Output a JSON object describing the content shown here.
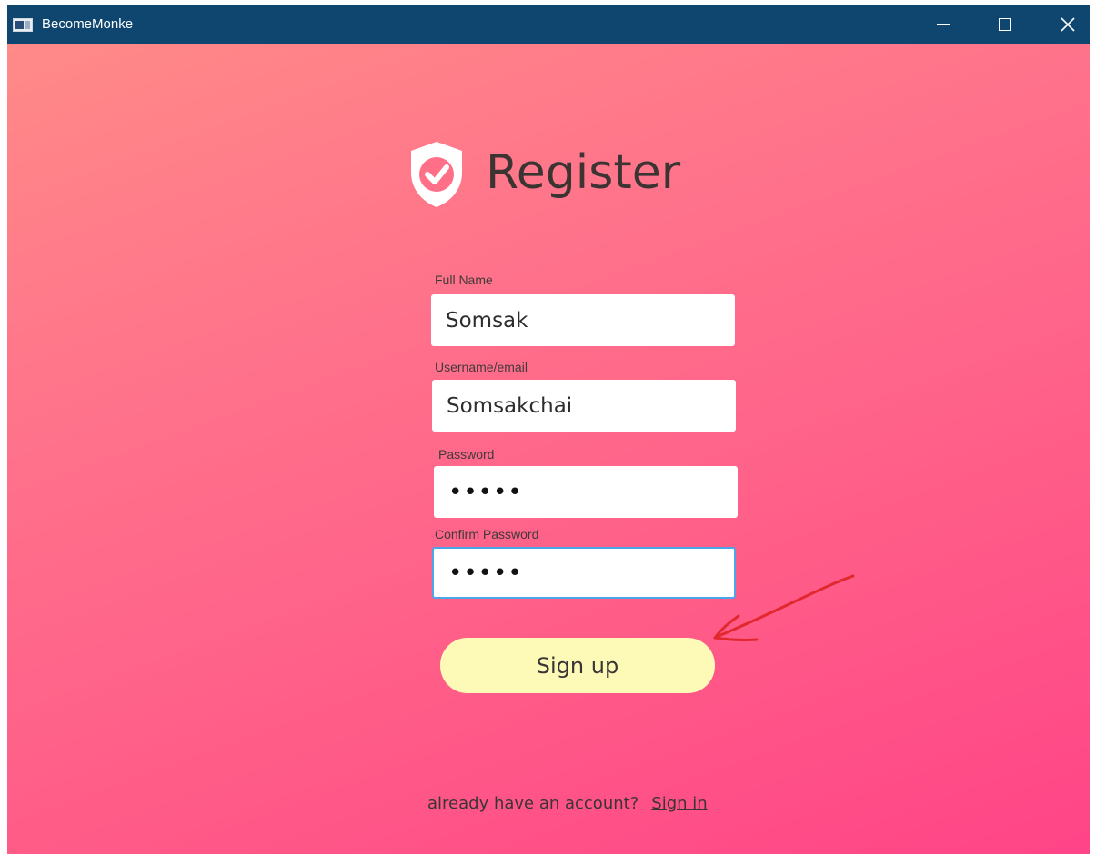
{
  "window": {
    "title": "BecomeMonke"
  },
  "header": {
    "title": "Register"
  },
  "form": {
    "full_name": {
      "label": "Full Name",
      "value": "Somsak"
    },
    "username": {
      "label": "Username/email",
      "value": "Somsakchai"
    },
    "password": {
      "label": "Password",
      "value": "•••••"
    },
    "confirm_password": {
      "label": "Confirm Password",
      "value": "•••••"
    },
    "submit_label": "Sign up"
  },
  "footer": {
    "prompt": "already have an account?",
    "signin_label": "Sign in"
  },
  "icons": {
    "app": "app-window-icon",
    "logo": "shield-check-icon",
    "minimize": "minimize-icon",
    "maximize": "maximize-icon",
    "close": "close-icon"
  },
  "colors": {
    "titlebar": "#0f4670",
    "gradient_start": "#ff8a88",
    "gradient_end": "#ff4487",
    "signup_button": "#fdfab7",
    "annotation": "#e0282e",
    "focus_border": "#4aa6e8"
  }
}
